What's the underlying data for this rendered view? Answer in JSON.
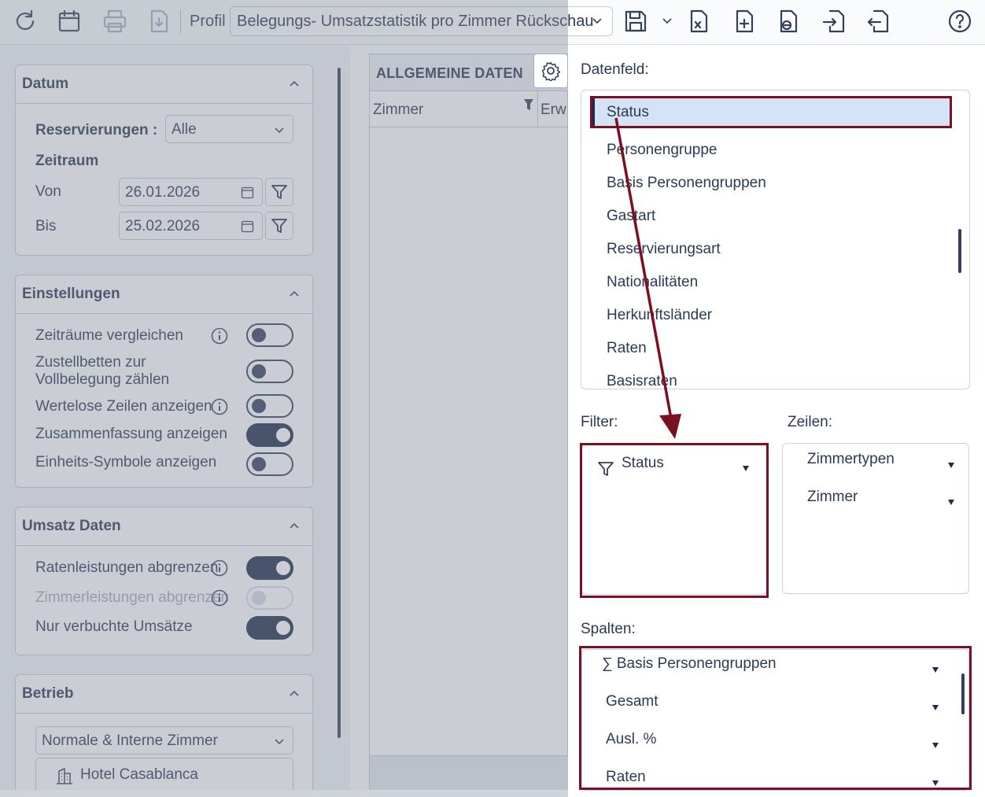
{
  "toolbar": {
    "icons": [
      "refresh-icon",
      "calendar-icon",
      "print-icon",
      "export-icon",
      "save-icon",
      "chevron-down-icon",
      "excel-export-icon",
      "add-file-icon",
      "copy-file-icon",
      "import-icon",
      "export-file-icon",
      "help-icon"
    ],
    "profil_label": "Profil",
    "profil_value": "Belegungs- Umsatzstatistik pro Zimmer Rückschau"
  },
  "sidebar": {
    "datum": {
      "title": "Datum",
      "reservierungen_label": "Reservierungen :",
      "reservierungen_value": "Alle",
      "zeitraum_label": "Zeitraum",
      "von_label": "Von",
      "von_value": "26.01.2026",
      "bis_label": "Bis",
      "bis_value": "25.02.2026"
    },
    "einstellungen": {
      "title": "Einstellungen",
      "items": [
        {
          "label": "Zeiträume vergleichen",
          "on": false,
          "info": true
        },
        {
          "label": "Zustellbetten zur Vollbelegung zählen",
          "on": false,
          "info": false
        },
        {
          "label": "Wertelose Zeilen anzeigen",
          "on": false,
          "info": true
        },
        {
          "label": "Zusammenfassung anzeigen",
          "on": true,
          "info": false
        },
        {
          "label": "Einheits-Symbole anzeigen",
          "on": false,
          "info": false
        }
      ]
    },
    "umsatz": {
      "title": "Umsatz Daten",
      "items": [
        {
          "label": "Ratenleistungen abgrenzen",
          "on": true,
          "disabled": false
        },
        {
          "label": "Zimmerleistungen abgrenzen",
          "on": false,
          "disabled": true
        },
        {
          "label": "Nur verbuchte Umsätze",
          "on": true,
          "disabled": false
        }
      ]
    },
    "betrieb": {
      "title": "Betrieb",
      "zimmer_select": "Normale & Interne Zimmer",
      "hotel": "Hotel Casablanca"
    }
  },
  "grid": {
    "title": "ALLGEMEINE DATEN",
    "columns": [
      "Zimmer",
      "Erw"
    ]
  },
  "chooser": {
    "datenfeld_label": "Datenfeld:",
    "datenfeld_items": [
      "Status",
      "Personengruppe",
      "Basis Personengruppen",
      "Gastart",
      "Reservierungsart",
      "Nationalitäten",
      "Herkunftsländer",
      "Raten",
      "Basisraten"
    ],
    "selected_item": "Status",
    "filter_label": "Filter:",
    "filter_items": [
      "Status"
    ],
    "zeilen_label": "Zeilen:",
    "zeilen_items": [
      "Zimmertypen",
      "Zimmer"
    ],
    "spalten_label": "Spalten:",
    "spalten_items": [
      "∑  Basis Personengruppen",
      "Gesamt",
      "Ausl. %",
      "Raten"
    ]
  },
  "annotation_color": "#7a1022",
  "accent_color": "#1f2d4c"
}
